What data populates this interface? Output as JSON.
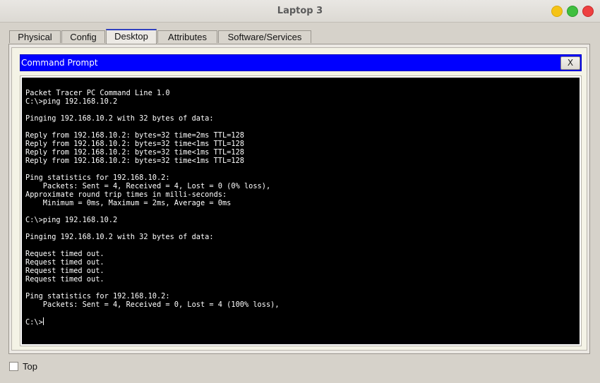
{
  "window": {
    "title": "Laptop 3"
  },
  "tabs": [
    {
      "label": "Physical",
      "active": false
    },
    {
      "label": "Config",
      "active": false
    },
    {
      "label": "Desktop",
      "active": true
    },
    {
      "label": "Attributes",
      "active": false
    },
    {
      "label": "Software/Services",
      "active": false
    }
  ],
  "command_prompt": {
    "title": "Command Prompt",
    "close_label": "X",
    "lines": [
      "Packet Tracer PC Command Line 1.0",
      "C:\\>ping 192.168.10.2",
      "",
      "Pinging 192.168.10.2 with 32 bytes of data:",
      "",
      "Reply from 192.168.10.2: bytes=32 time=2ms TTL=128",
      "Reply from 192.168.10.2: bytes=32 time<1ms TTL=128",
      "Reply from 192.168.10.2: bytes=32 time<1ms TTL=128",
      "Reply from 192.168.10.2: bytes=32 time<1ms TTL=128",
      "",
      "Ping statistics for 192.168.10.2:",
      "    Packets: Sent = 4, Received = 4, Lost = 0 (0% loss),",
      "Approximate round trip times in milli-seconds:",
      "    Minimum = 0ms, Maximum = 2ms, Average = 0ms",
      "",
      "C:\\>ping 192.168.10.2",
      "",
      "Pinging 192.168.10.2 with 32 bytes of data:",
      "",
      "Request timed out.",
      "Request timed out.",
      "Request timed out.",
      "Request timed out.",
      "",
      "Ping statistics for 192.168.10.2:",
      "    Packets: Sent = 4, Received = 0, Lost = 4 (100% loss),",
      "",
      "C:\\>"
    ]
  },
  "bottom": {
    "top_label": "Top",
    "top_checked": false
  },
  "colors": {
    "cmd_titlebar": "#0000ff",
    "terminal_bg": "#000000",
    "terminal_fg": "#ffffff",
    "active_tab_accent": "#2f3fc0"
  }
}
